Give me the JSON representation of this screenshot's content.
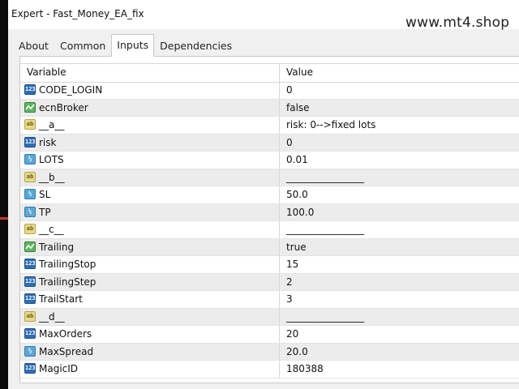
{
  "window": {
    "title": "Expert - Fast_Money_EA_fix"
  },
  "watermark": "www.mt4.shop",
  "tabs": [
    {
      "label": "About",
      "active": false
    },
    {
      "label": "Common",
      "active": false
    },
    {
      "label": "Inputs",
      "active": true
    },
    {
      "label": "Dependencies",
      "active": false
    }
  ],
  "table": {
    "headers": {
      "variable": "Variable",
      "value": "Value"
    },
    "rows": [
      {
        "name": "CODE_LOGIN",
        "value": "0",
        "type": "int-icon"
      },
      {
        "name": "ecnBroker",
        "value": "false",
        "type": "bool-icon"
      },
      {
        "name": "__a__",
        "value": "risk: 0-->fixed lots",
        "type": "string-icon"
      },
      {
        "name": "risk",
        "value": "0",
        "type": "int-icon"
      },
      {
        "name": "LOTS",
        "value": "0.01",
        "type": "double-icon"
      },
      {
        "name": "__b__",
        "value": "________________",
        "type": "string-icon"
      },
      {
        "name": "SL",
        "value": "50.0",
        "type": "double-icon"
      },
      {
        "name": "TP",
        "value": "100.0",
        "type": "double-icon"
      },
      {
        "name": "__c__",
        "value": "________________",
        "type": "string-icon"
      },
      {
        "name": "Trailing",
        "value": "true",
        "type": "bool-icon"
      },
      {
        "name": "TrailingStop",
        "value": "15",
        "type": "int-icon"
      },
      {
        "name": "TrailingStep",
        "value": "2",
        "type": "int-icon"
      },
      {
        "name": "TrailStart",
        "value": "3",
        "type": "int-icon"
      },
      {
        "name": "__d__",
        "value": "________________",
        "type": "string-icon"
      },
      {
        "name": "MaxOrders",
        "value": "20",
        "type": "int-icon"
      },
      {
        "name": "MaxSpread",
        "value": "20.0",
        "type": "double-icon"
      },
      {
        "name": "MagicID",
        "value": "180388",
        "type": "int-icon"
      }
    ]
  },
  "colors": {
    "int_icon": "#2f6db5",
    "double_icon": "#5aa7d8",
    "string_icon": "#e7d98a",
    "bool_icon": "#5fb55f",
    "alt_row": "#ececec"
  }
}
